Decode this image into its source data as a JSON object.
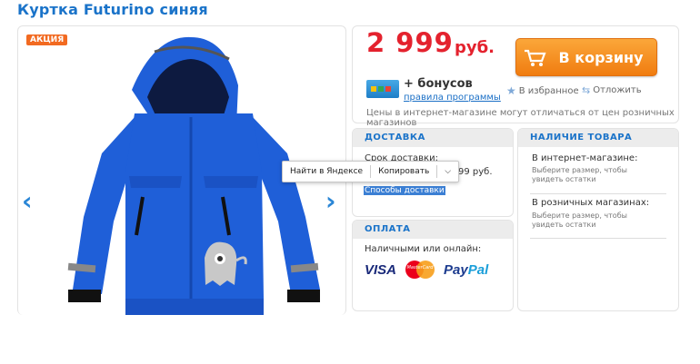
{
  "product": {
    "title": "Куртка Futurino синяя",
    "badge": "АКЦИЯ"
  },
  "gallery": {
    "prev_icon": "chevron-left-icon",
    "next_icon": "chevron-right-icon"
  },
  "price": {
    "amount": "2 999",
    "currency": "руб."
  },
  "cart": {
    "label": "В корзину",
    "icon": "cart-icon"
  },
  "bonus": {
    "text": "+ бонусов",
    "link": "правила программы"
  },
  "actions": {
    "favorite": "В избранное",
    "defer": "Отложить"
  },
  "disclaimer": "Цены в интернет-магазине могут отличаться от цен розничных магазинов",
  "delivery": {
    "header": "ДОСТАВКА",
    "term_label": "Срок доставки:",
    "price_frag": "99 руб.",
    "methods_link": "Способы доставки"
  },
  "context_menu": {
    "find": "Найти в Яндексе",
    "copy": "Копировать"
  },
  "stock": {
    "header": "НАЛИЧИЕ ТОВАРА",
    "online_label": "В интернет-магазине:",
    "online_hint": "Выберите размер, чтобы увидеть остатки",
    "retail_label": "В розничных магазинах:",
    "retail_hint": "Выберите размер, чтобы увидеть остатки"
  },
  "payment": {
    "header": "ОПЛАТА",
    "label": "Наличными или онлайн:",
    "visa": "VISA",
    "mastercard": "MasterCard",
    "paypal_a": "Pay",
    "paypal_b": "Pal"
  },
  "colors": {
    "accent": "#1a73c9",
    "price": "#e4222e",
    "cart": "#f07c10",
    "jacket": "#1f5fd8"
  }
}
